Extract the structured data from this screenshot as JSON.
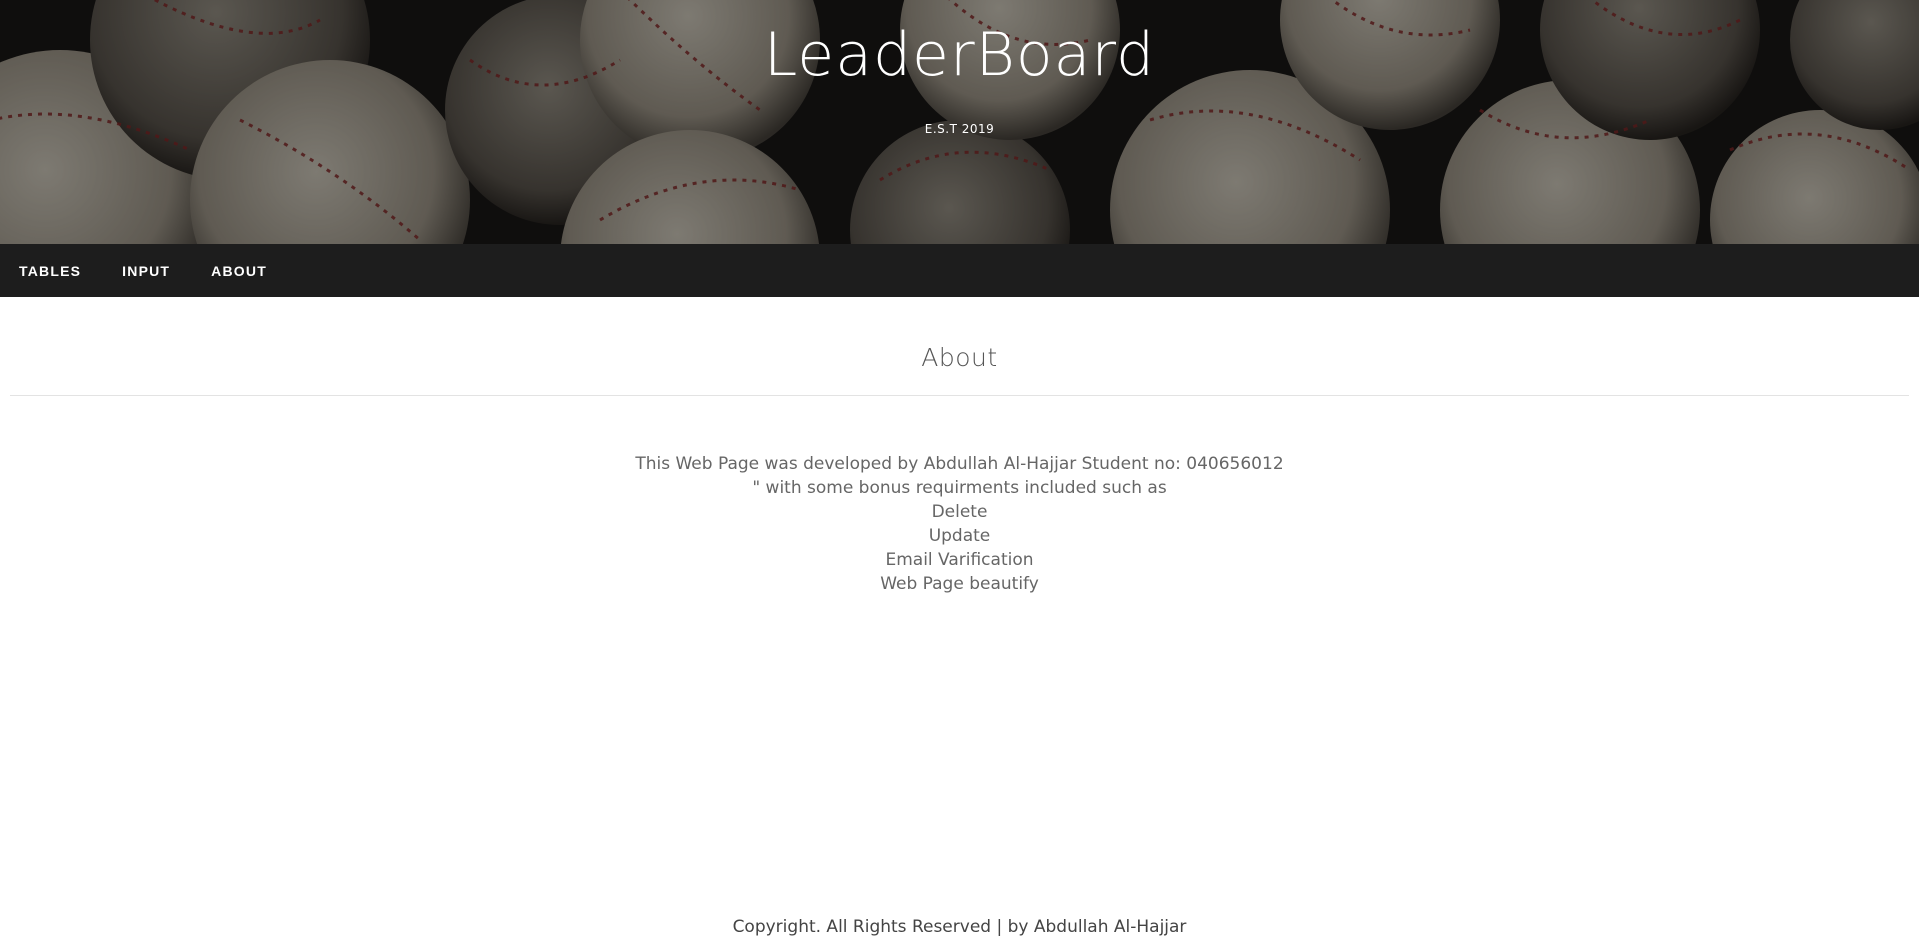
{
  "header": {
    "title": "LeaderBoard",
    "subtitle": "E.S.T 2019",
    "background_image": "baseballs-photo",
    "text_color": "#ffffff"
  },
  "nav": {
    "items": [
      {
        "label": "TABLES"
      },
      {
        "label": "INPUT"
      },
      {
        "label": "ABOUT"
      }
    ],
    "background_color": "#1d1d1d"
  },
  "main": {
    "heading": "About",
    "lines": [
      "This Web Page was developed by Abdullah Al-Hajjar Student no: 040656012",
      "\" with some bonus requirments included such as",
      "Delete",
      "Update",
      "Email Varification",
      "Web Page beautify"
    ]
  },
  "footer": {
    "text": "Copyright. All Rights Reserved | by Abdullah Al-Hajjar"
  }
}
